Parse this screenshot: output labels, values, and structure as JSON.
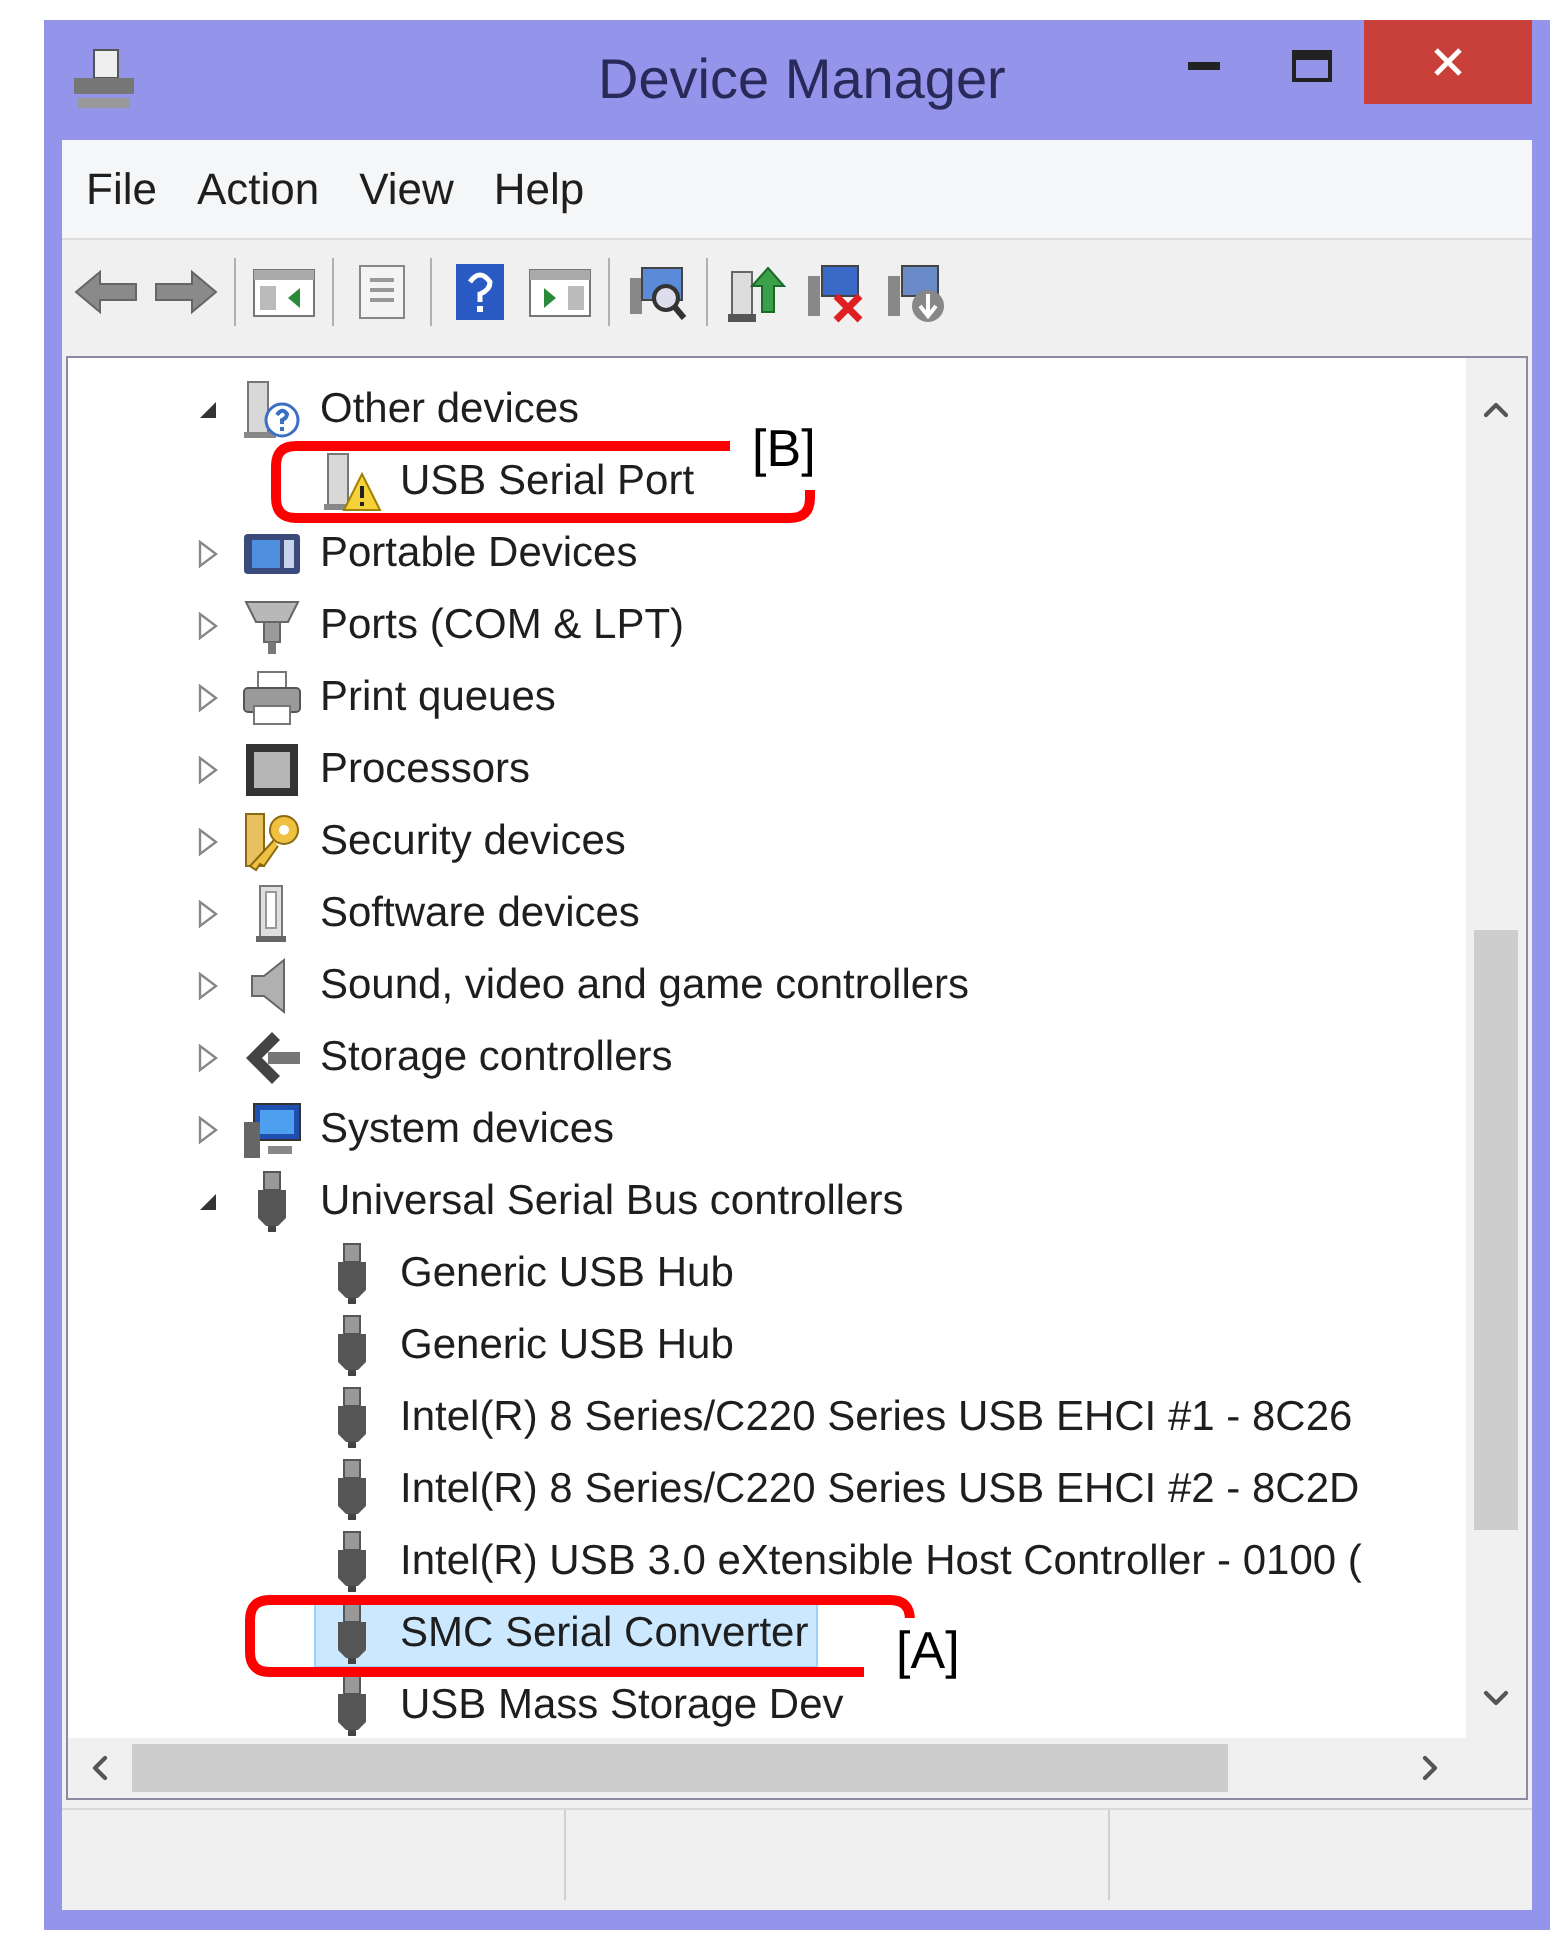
{
  "window": {
    "title": "Device Manager"
  },
  "menu": [
    {
      "label": "File"
    },
    {
      "label": "Action"
    },
    {
      "label": "View"
    },
    {
      "label": "Help"
    }
  ],
  "tree": {
    "items": [
      {
        "label": "Other devices",
        "kind": "other",
        "expanded": true,
        "selected": false,
        "children": [
          {
            "label": "USB Serial Port",
            "kind": "warning",
            "selected": false
          }
        ]
      },
      {
        "label": "Portable Devices",
        "kind": "portable",
        "expanded": false,
        "selected": false
      },
      {
        "label": "Ports (COM & LPT)",
        "kind": "ports",
        "expanded": false,
        "selected": false
      },
      {
        "label": "Print queues",
        "kind": "printer",
        "expanded": false,
        "selected": false
      },
      {
        "label": "Processors",
        "kind": "processor",
        "expanded": false,
        "selected": false
      },
      {
        "label": "Security devices",
        "kind": "security",
        "expanded": false,
        "selected": false
      },
      {
        "label": "Software devices",
        "kind": "software",
        "expanded": false,
        "selected": false
      },
      {
        "label": "Sound, video and game controllers",
        "kind": "sound",
        "expanded": false,
        "selected": false
      },
      {
        "label": "Storage controllers",
        "kind": "storage",
        "expanded": false,
        "selected": false
      },
      {
        "label": "System devices",
        "kind": "system",
        "expanded": false,
        "selected": false
      },
      {
        "label": "Universal Serial Bus controllers",
        "kind": "usb",
        "expanded": true,
        "selected": false,
        "children": [
          {
            "label": "Generic USB Hub",
            "kind": "usb",
            "selected": false
          },
          {
            "label": "Generic USB Hub",
            "kind": "usb",
            "selected": false
          },
          {
            "label": "Intel(R) 8 Series/C220 Series USB EHCI #1 - 8C26",
            "kind": "usb",
            "selected": false
          },
          {
            "label": "Intel(R) 8 Series/C220 Series USB EHCI #2 - 8C2D",
            "kind": "usb",
            "selected": false
          },
          {
            "label": "Intel(R) USB 3.0 eXtensible Host Controller - 0100 (",
            "kind": "usb",
            "selected": false
          },
          {
            "label": "SMC Serial Converter",
            "kind": "usb",
            "selected": true
          },
          {
            "label": "USB Mass Storage Dev",
            "kind": "usb",
            "selected": false
          }
        ]
      }
    ]
  },
  "annotations": [
    {
      "label": "[B]"
    },
    {
      "label": "[A]"
    }
  ]
}
